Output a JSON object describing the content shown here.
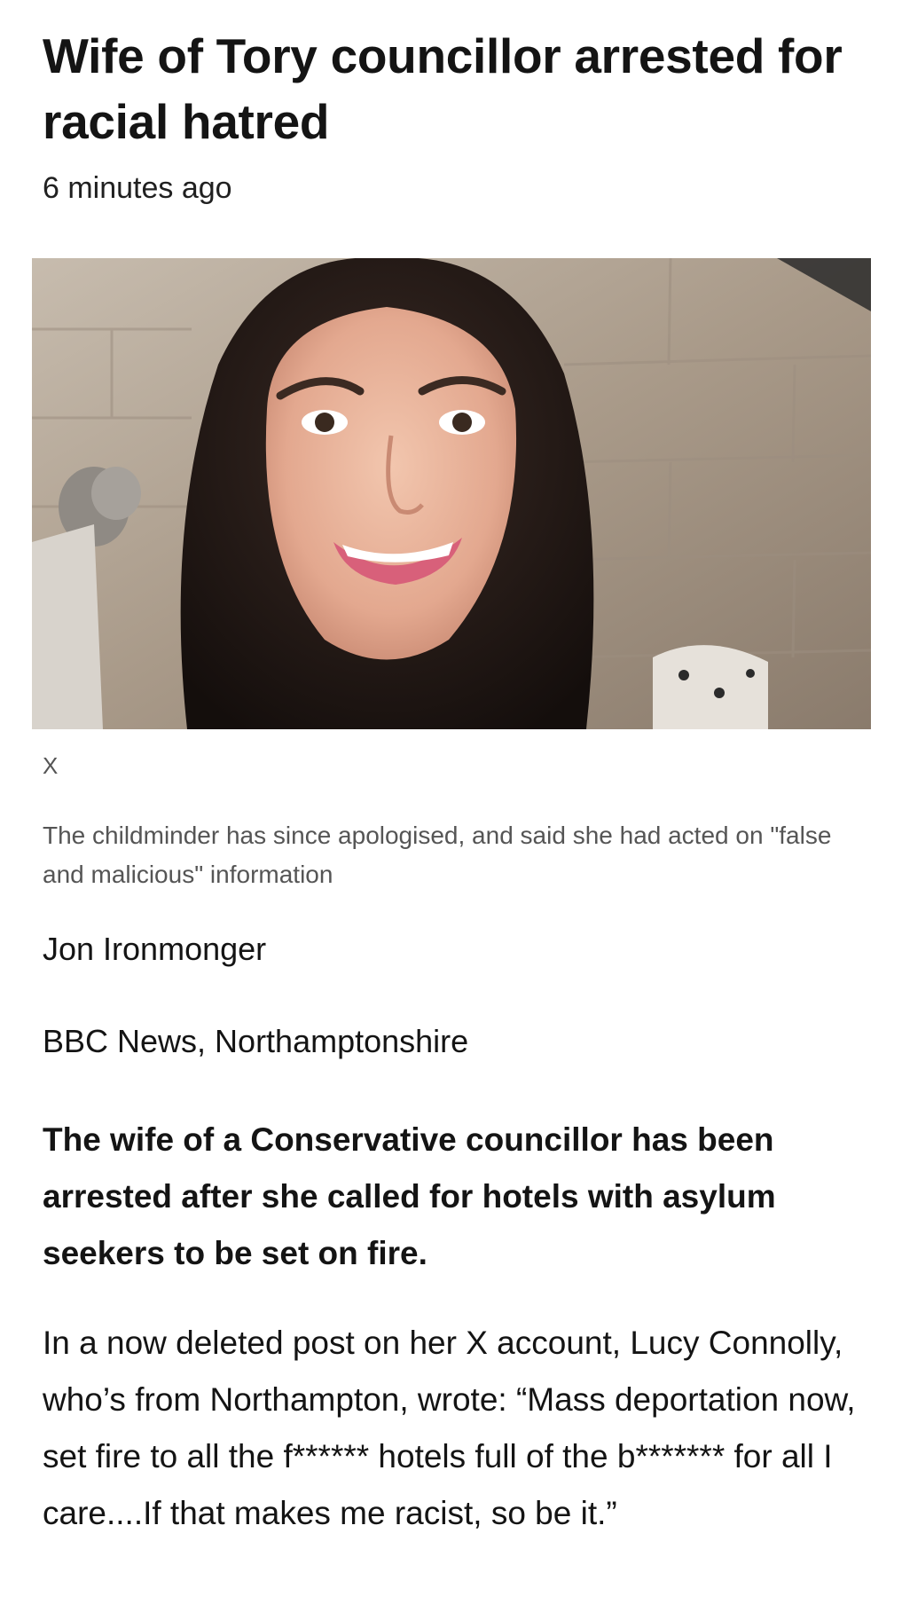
{
  "article": {
    "headline": "Wife of Tory councillor arrested for racial hatred",
    "timestamp": "6 minutes ago",
    "image": {
      "close_glyph": "X",
      "caption": "The childminder has since apologised, and said she had acted on \"false and malicious\" information"
    },
    "byline": {
      "author": "Jon Ironmonger",
      "outlet": "BBC News, Northamptonshire"
    },
    "lede": "The wife of a Conservative councillor has been arrested after she called for hotels with asylum seekers to be set on fire.",
    "paragraphs": [
      "In a now deleted post on her X account, Lucy Connolly, who’s from Northampton, wrote: “Mass deportation now, set fire to all the f****** hotels full of the b******* for all I care....If that makes me racist, so be it.”"
    ]
  },
  "colors": {
    "text": "#141414",
    "caption": "#555555",
    "background": "#ffffff"
  }
}
